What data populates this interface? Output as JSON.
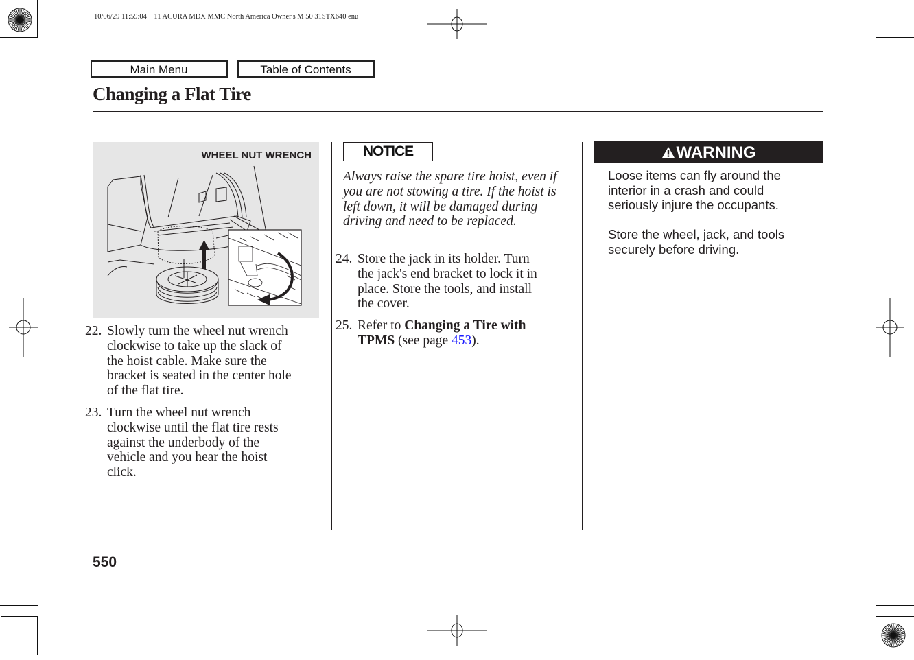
{
  "print_header": "10/06/29 11:59:04    11 ACURA MDX MMC North America Owner's M 50 31STX640 enu",
  "nav": {
    "main_menu": "Main Menu",
    "table_of_contents": "Table of Contents"
  },
  "page_title": "Changing a Flat Tire",
  "figure": {
    "callout": "WHEEL NUT WRENCH"
  },
  "steps_left": [
    {
      "number": "22.",
      "lines": [
        "Slowly turn the wheel nut wrench",
        "clockwise to take up the slack of",
        "the hoist cable. Make sure the",
        "bracket is seated in the center hole",
        "of the flat tire."
      ]
    },
    {
      "number": "23.",
      "lines": [
        "Turn the wheel nut wrench",
        "clockwise until the flat tire rests",
        "against the underbody of the",
        "vehicle and you hear the hoist",
        "click."
      ]
    }
  ],
  "notice": {
    "label": "NOTICE",
    "lines": [
      "Always raise the spare tire hoist, even if",
      "you are not stowing a tire. If the hoist is",
      "left down, it will be damaged during",
      "driving and need to be replaced."
    ]
  },
  "steps_middle": [
    {
      "number": "24.",
      "lines": [
        "Store the jack in its holder. Turn",
        "the jack's end bracket to lock it in",
        "place. Store the tools, and install",
        "the cover."
      ]
    },
    {
      "number": "25.",
      "prefix": "Refer to ",
      "bold_line1": "Changing a Tire with",
      "bold_line2": "TPMS",
      "see_page_prefix": " (see page ",
      "page_link": "453",
      "suffix": ")."
    }
  ],
  "warning": {
    "label": "WARNING",
    "icon": "warning-triangle-icon",
    "paragraphs": [
      [
        "Loose items can fly around the",
        "interior in a crash and could",
        "seriously injure the occupants."
      ],
      [
        "Store the wheel, jack, and tools",
        "securely before driving."
      ]
    ]
  },
  "page_number": "550",
  "colors": {
    "text": "#231f20",
    "link": "#1a1aff",
    "figure_bg": "#e6e6e6",
    "warning_header_bg": "#231f20"
  }
}
